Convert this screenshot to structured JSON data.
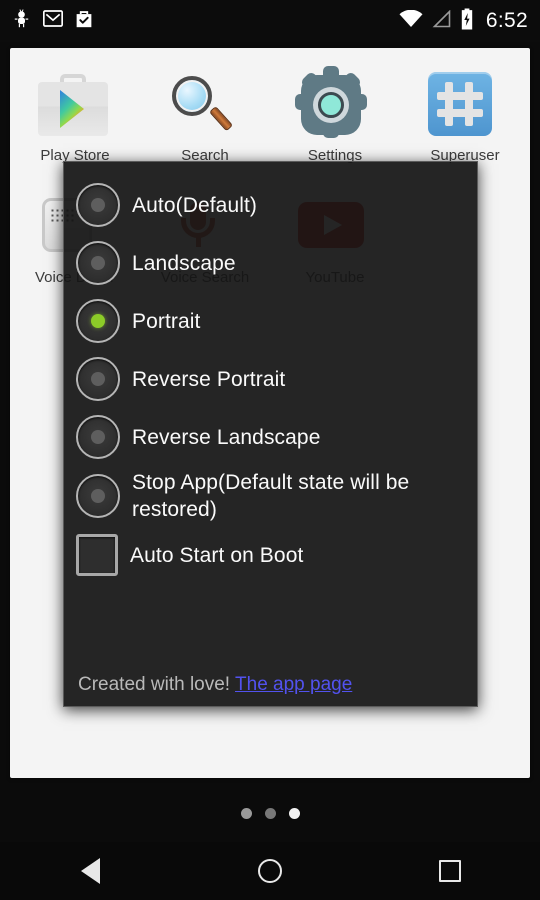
{
  "statusbar": {
    "icons": [
      "android-debug-icon",
      "gmail-icon",
      "play-store-notification-icon"
    ],
    "right_icons": [
      "wifi-icon",
      "cell-signal-icon",
      "battery-charging-icon"
    ],
    "clock": "6:52"
  },
  "home": {
    "apps_row1": [
      {
        "label": "Play Store",
        "icon": "play-store-icon"
      },
      {
        "label": "Search",
        "icon": "search-magnifier-icon"
      },
      {
        "label": "Settings",
        "icon": "settings-gear-icon"
      },
      {
        "label": "Superuser",
        "icon": "superuser-hash-icon"
      }
    ],
    "apps_row2": [
      {
        "label": "Voice Dialer",
        "icon": "voice-dialer-icon"
      },
      {
        "label": "Voice Search",
        "icon": "microphone-icon"
      },
      {
        "label": "YouTube",
        "icon": "youtube-icon"
      }
    ],
    "page_dots": {
      "count": 3,
      "active_index": 2
    }
  },
  "dialog": {
    "options": [
      {
        "label": "Auto(Default)",
        "selected": false
      },
      {
        "label": "Landscape",
        "selected": false
      },
      {
        "label": "Portrait",
        "selected": true
      },
      {
        "label": "Reverse Portrait",
        "selected": false
      },
      {
        "label": "Reverse Landscape",
        "selected": false
      },
      {
        "label": "Stop App(Default state will be restored)",
        "selected": false
      }
    ],
    "checkbox": {
      "label": "Auto Start on Boot",
      "checked": false
    },
    "footer_text": "Created with love!",
    "footer_link": "The app page",
    "accent_color": "#8ccc28",
    "link_color": "#5252ef"
  },
  "navbar": {
    "back": "back-button",
    "home": "home-button",
    "recents": "recents-button"
  }
}
